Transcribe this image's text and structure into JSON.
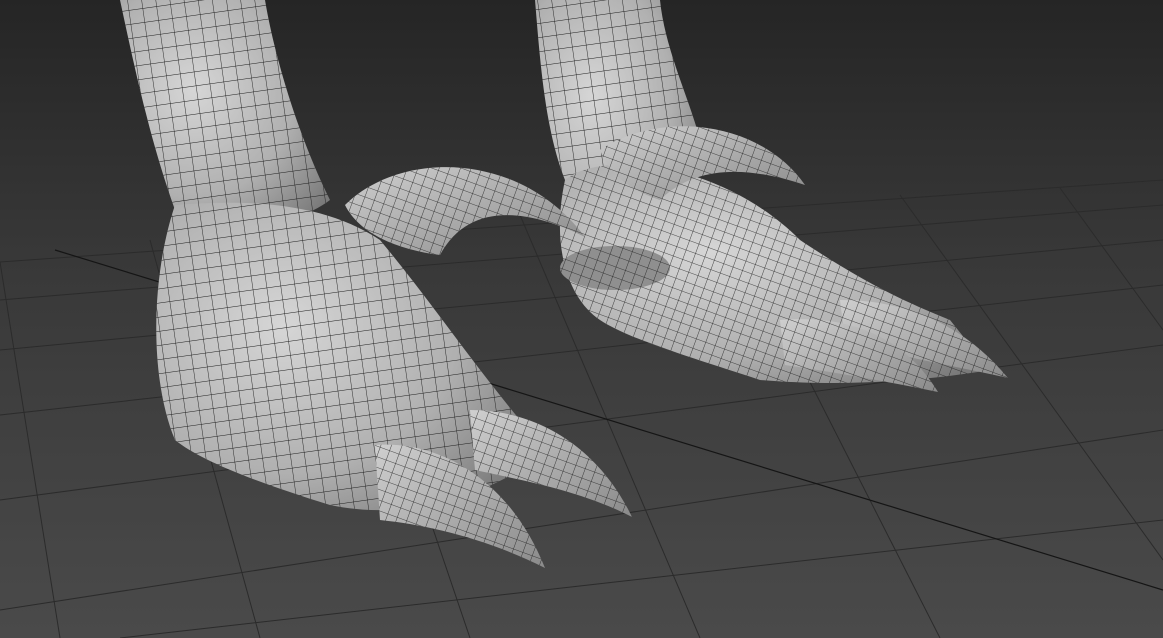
{
  "viewport": {
    "kind": "3d-modeling-viewport",
    "display_mode": "shaded-with-wireframe",
    "background_color": "#3b3b3b",
    "grid_color": "#2a2a2a",
    "grid_axis_color": "#1a1a1a",
    "mesh_color": "#b9b9b9",
    "wire_color": "#1e1e1e"
  },
  "scene": {
    "objects": [
      {
        "name": "left-foot",
        "type": "clawed-foot-mesh",
        "claws": 3
      },
      {
        "name": "right-foot",
        "type": "clawed-foot-mesh",
        "claws": 3
      }
    ]
  }
}
